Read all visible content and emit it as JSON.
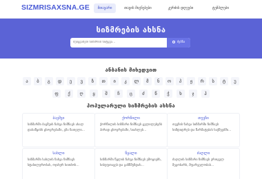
{
  "logo": "SIZMRISAXSNA.GE",
  "nav": [
    "მთავარი",
    "თავის მიგნებები",
    "კერძის დღეები",
    "ტემპლები"
  ],
  "hero": {
    "title": "სიზმრების ახსნა",
    "search_placeholder": "შეიყვანეთ სიზმრის სიტყვა...",
    "search_button": "ძებნა"
  },
  "alphabet": {
    "title": "ანბანის მიხედვით",
    "row1": [
      "ა",
      "ბ",
      "გ",
      "დ",
      "ე",
      "ვ",
      "ზ",
      "თ",
      "ი",
      "კ",
      "ლ",
      "მ",
      "ნ",
      "ო",
      "პ",
      "ჟ",
      "რ",
      "ს",
      "ტ",
      "უ"
    ],
    "row2": [
      "ფ",
      "ქ",
      "ღ",
      "ყ",
      "შ",
      "ჩ",
      "ც",
      "ძ",
      "წ",
      "ჭ",
      "ხ",
      "ჯ",
      "ჰ"
    ]
  },
  "popular": {
    "title": "პოპულარული სიზმრების ახსნა",
    "cards": [
      {
        "title": "ბავშვი",
        "text": "სიზმარში ბავშვის ნახვა ნიშნავს ახალ დასაწყისს ცხოვრებაში, გზა ნათელი..."
      },
      {
        "title": "ქორწილი",
        "text": "ქორწილის სიზმარი ნიშნავს ცვლილებებს პირად ცხოვრებაში, სიახლეს..."
      },
      {
        "title": "თევზი",
        "text": "თევზის ნახვა სიზმარში ნიშნავს სიმდიდრეს და წარმატებას საქმეებში..."
      },
      {
        "title": "სახლი",
        "text": "სიზმარში სახლის ნახვა ნიშნავს სტაბილურობას, ოჯახურ სითბოს..."
      },
      {
        "title": "წყალი",
        "text": "სიზმარში წყლის ნახვა ნიშნავს ემოციებს, სისუფთავეს და განწმენდას..."
      },
      {
        "title": "ძაღლი",
        "text": "ძაღლის სიზმარი ნიშნავს ერთგულ მეგობარს, მფარველობას..."
      }
    ]
  }
}
